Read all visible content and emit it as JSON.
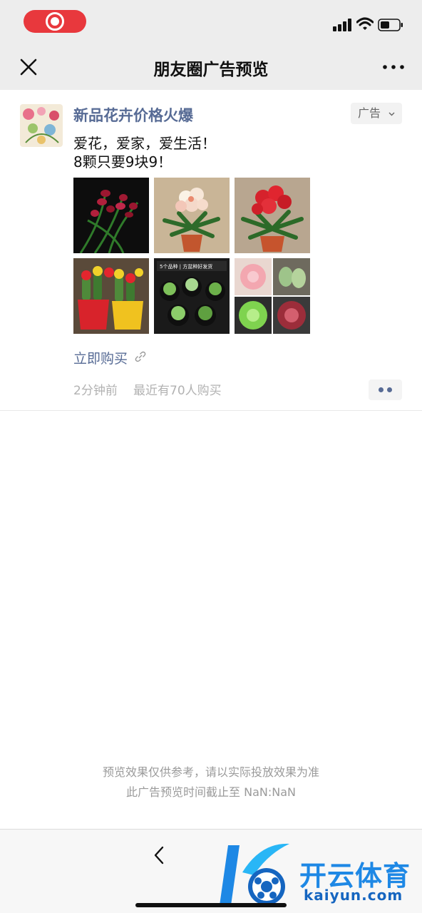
{
  "nav": {
    "title": "朋友圈广告预览"
  },
  "post": {
    "advertiser_name": "新品花卉价格火爆",
    "ad_tag": "广告",
    "text_line1": "爱花，爱家，爱生活！",
    "text_line2": "8颗只要9块9！",
    "images": [
      {
        "icon": "red-orchid-photo"
      },
      {
        "icon": "white-clivia-photo"
      },
      {
        "icon": "red-clivia-photo"
      },
      {
        "icon": "cactus-pots-photo"
      },
      {
        "icon": "succulent-tray-photo",
        "caption": "5个品种 | 方盆种好发货"
      },
      {
        "icon": "succulent-collage-photo"
      }
    ],
    "cta_label": "立即购买",
    "time": "2分钟前",
    "buyers": "最近有70人购买"
  },
  "footer": {
    "note1": "预览效果仅供参考，请以实际投放效果为准",
    "note2": "此广告预览时间截止至 NaN:NaN"
  },
  "watermark": {
    "cn": "开云体育",
    "en": "kaiyun.com"
  },
  "colors": {
    "link_blue": "#576b95",
    "record_red": "#e8383d",
    "bar_gray": "#ededed"
  }
}
